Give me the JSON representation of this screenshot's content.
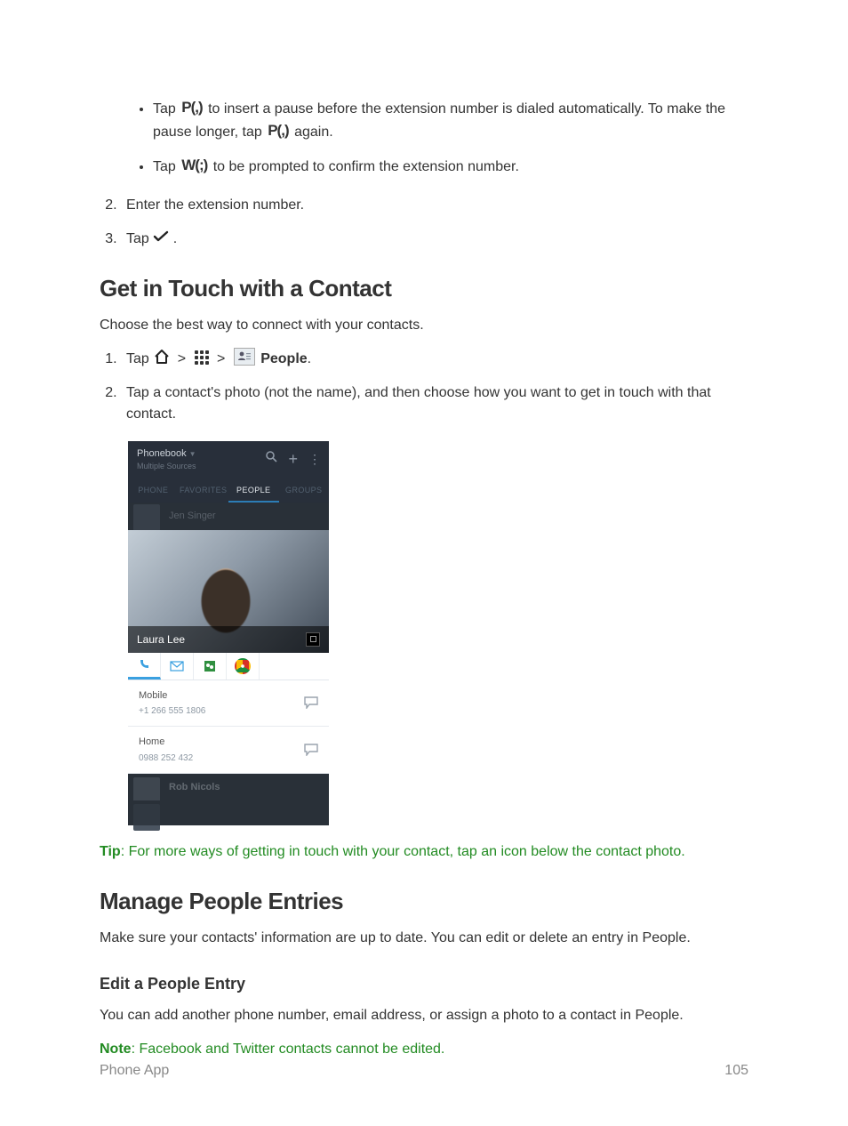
{
  "bullets": {
    "pause1_a": "Tap ",
    "pause1_b": " to insert a pause before the extension number is dialed automatically. To make the pause longer, tap ",
    "pause1_c": " again.",
    "wait_a": "Tap ",
    "wait_b": " to be prompted to confirm the extension number."
  },
  "steps_top": {
    "s2": "Enter the extension number.",
    "s3_a": "Tap ",
    "s3_b": " ."
  },
  "section1": {
    "title": "Get in Touch with a Contact",
    "intro": "Choose the best way to connect with your contacts.",
    "step1_a": "Tap ",
    "chev": " > ",
    "chev2": " > ",
    "people_label": " People",
    "step1_b": ".",
    "step2": "Tap a contact's photo (not the name), and then choose how you want to get in touch with that contact."
  },
  "tip": {
    "label": "Tip",
    "text": ": For more ways of getting in touch with your contact, tap an icon below the contact photo."
  },
  "section2": {
    "title": "Manage People Entries",
    "intro": "Make sure your contacts' information are up to date. You can edit or delete an entry in People."
  },
  "subsection": {
    "title": "Edit a People Entry",
    "intro": "You can add another phone number, email address, or assign a photo to a contact in People."
  },
  "note": {
    "label": "Note",
    "text": ": Facebook and Twitter contacts cannot be edited."
  },
  "phone": {
    "title": "Phonebook",
    "subtitle": "Multiple Sources",
    "tabs": [
      "PHONE",
      "FAVORITES",
      "PEOPLE",
      "GROUPS"
    ],
    "dim_top_name": "Jen Singer",
    "card_name": "Laura Lee",
    "num1_label": "Mobile",
    "num1_value": "+1 266 555 1806",
    "num2_label": "Home",
    "num2_value": "0988 252 432",
    "dim_bottom_name": "Rob Nicols"
  },
  "icons": {
    "p_pause": "P(,)",
    "w_wait": "W(;)"
  },
  "footer": {
    "left": "Phone App",
    "right": "105"
  }
}
